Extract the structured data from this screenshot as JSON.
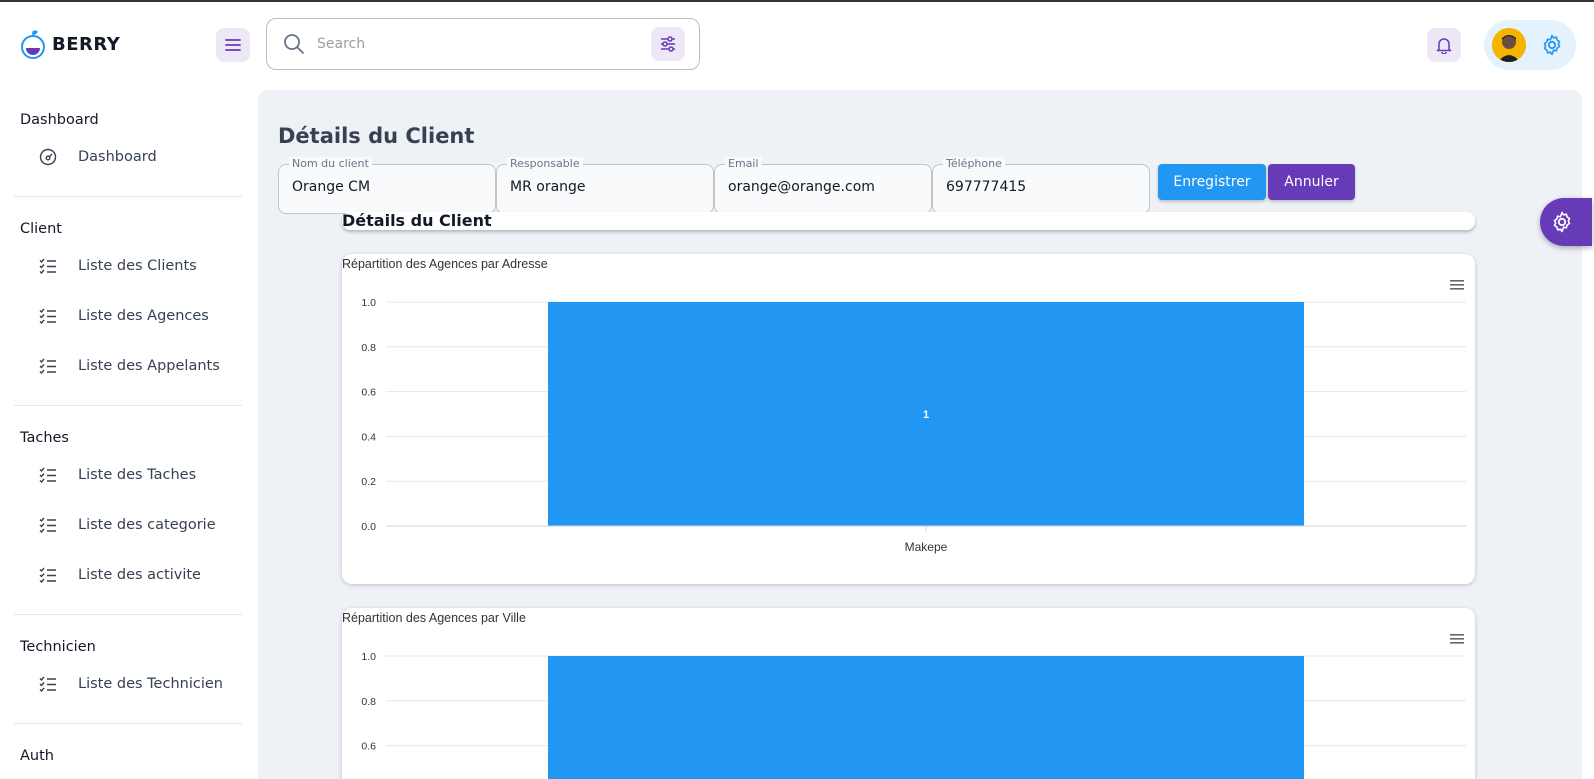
{
  "app": {
    "brand": "BERRY"
  },
  "search": {
    "placeholder": "Search",
    "value": ""
  },
  "sidebar": {
    "groups": [
      {
        "title": "Dashboard",
        "items": [
          {
            "label": "Dashboard",
            "icon": "dashboard-icon"
          }
        ]
      },
      {
        "title": "Client",
        "items": [
          {
            "label": "Liste des Clients",
            "icon": "list-check-icon"
          },
          {
            "label": "Liste des Agences",
            "icon": "list-check-icon"
          },
          {
            "label": "Liste des Appelants",
            "icon": "list-check-icon"
          }
        ]
      },
      {
        "title": "Taches",
        "items": [
          {
            "label": "Liste des Taches",
            "icon": "list-check-icon"
          },
          {
            "label": "Liste des categorie",
            "icon": "list-check-icon"
          },
          {
            "label": "Liste des activite",
            "icon": "list-check-icon"
          }
        ]
      },
      {
        "title": "Technicien",
        "items": [
          {
            "label": "Liste des Technicien",
            "icon": "list-check-icon"
          }
        ]
      },
      {
        "title": "Auth",
        "items": []
      }
    ]
  },
  "main": {
    "title": "Détails du Client",
    "fields": {
      "nom": {
        "label": "Nom du client",
        "value": "Orange CM"
      },
      "responsable": {
        "label": "Responsable",
        "value": "MR orange"
      },
      "email": {
        "label": "Email",
        "value": "orange@orange.com"
      },
      "telephone": {
        "label": "Téléphone",
        "value": "697777415"
      }
    },
    "save_label": "Enregistrer",
    "cancel_label": "Annuler",
    "section_title": "Détails du Client"
  },
  "colors": {
    "primary": "#673ab7",
    "secondary": "#2196f3",
    "bar": "#2196f3",
    "background": "#eef2f6"
  },
  "chart_data": [
    {
      "type": "bar",
      "title": "Répartition des Agences par Adresse",
      "categories": [
        "Makepe"
      ],
      "values": [
        1
      ],
      "ylim": [
        0,
        1
      ],
      "yticks": [
        "0.0",
        "0.2",
        "0.4",
        "0.6",
        "0.8",
        "1.0"
      ],
      "data_labels": [
        "1"
      ],
      "grid": true,
      "menu_icon": "hamburger-menu-icon"
    },
    {
      "type": "bar",
      "title": "Répartition des Agences par Ville",
      "categories": [],
      "values": [
        1
      ],
      "ylim": [
        0,
        1
      ],
      "yticks": [
        "0.6",
        "0.8",
        "1.0"
      ],
      "grid": true,
      "menu_icon": "hamburger-menu-icon"
    }
  ]
}
